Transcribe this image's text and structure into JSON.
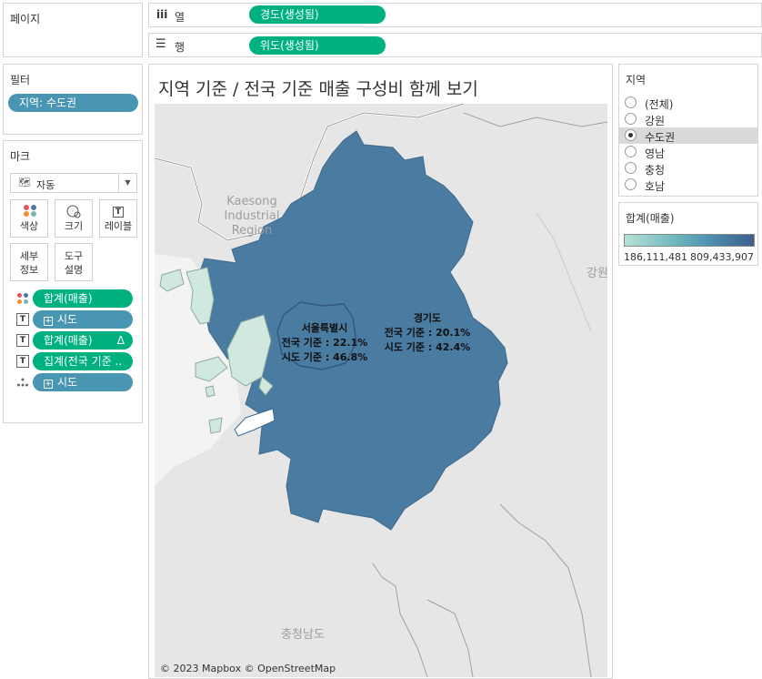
{
  "pages": {
    "title": "페이지"
  },
  "columns": {
    "label": "열",
    "pill": "경도(생성됨)"
  },
  "rows": {
    "label": "행",
    "pill": "위도(생성됨)"
  },
  "filters": {
    "title": "필터",
    "pill": "지역: 수도권"
  },
  "marks": {
    "title": "마크",
    "type_select": "자동",
    "buttons": {
      "color": "색상",
      "size": "크기",
      "label": "레이블",
      "detail": "세부\n정보",
      "tooltip": "도구\n설명"
    },
    "fields": [
      {
        "text": "합계(매출)",
        "kind": "green"
      },
      {
        "text": "시도",
        "kind": "blue"
      },
      {
        "text": "합계(매출)",
        "kind": "green",
        "delta": "Δ"
      },
      {
        "text": "집계(전국 기준 ..",
        "kind": "green"
      },
      {
        "text": "시도",
        "kind": "blue"
      }
    ]
  },
  "view": {
    "title": "지역 기준 / 전국 기준 매출 구성비 함께 보기",
    "attribution": "© 2023 Mapbox © OpenStreetMap",
    "map_labels": {
      "kaesong": [
        "Kaesong",
        "Industrial",
        "Region"
      ],
      "gangwon": "강원",
      "chungnam": "충청남도"
    },
    "regions": [
      {
        "name": "서울특별시",
        "national": "전국 기준 : 22.1%",
        "sido": "시도 기준 : 46.8%"
      },
      {
        "name": "경기도",
        "national": "전국 기준 : 20.1%",
        "sido": "시도 기준 : 42.4%"
      }
    ]
  },
  "region_filter": {
    "title": "지역",
    "options": [
      "(전체)",
      "강원",
      "수도권",
      "영남",
      "충청",
      "호남"
    ],
    "selected": "수도권"
  },
  "legend": {
    "title": "합계(매출)",
    "min": "186,111,481",
    "max": "809,433,907",
    "color_min": "#b6e2d6",
    "color_max": "#3d5f8c"
  },
  "colors": {
    "green_pill": "#00b180",
    "blue_pill": "#4996b2",
    "map_fill": "#4a7ba0"
  }
}
